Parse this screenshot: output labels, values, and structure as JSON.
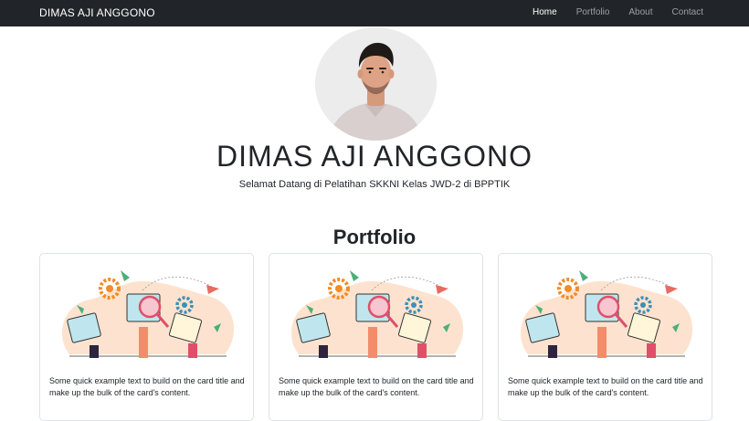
{
  "navbar": {
    "brand": "DIMAS AJI ANGGONO",
    "links": [
      {
        "label": "Home",
        "active": true
      },
      {
        "label": "Portfolio",
        "active": false
      },
      {
        "label": "About",
        "active": false
      },
      {
        "label": "Contact",
        "active": false
      }
    ]
  },
  "hero": {
    "name": "DIMAS AJI ANGGONO",
    "subtitle": "Selamat Datang di Pelatihan SKKNI Kelas JWD-2 di BPPTIK"
  },
  "portfolio": {
    "title": "Portfolio",
    "cards": [
      {
        "text": "Some quick example text to build on the card title and make up the bulk of the card's content."
      },
      {
        "text": "Some quick example text to build on the card title and make up the bulk of the card's content."
      },
      {
        "text": "Some quick example text to build on the card title and make up the bulk of the card's content."
      }
    ]
  },
  "colors": {
    "navbar_bg": "#212529",
    "accent_orange": "#f28c28",
    "accent_teal": "#3a8fb7",
    "blob_peach": "#fde3cf"
  }
}
